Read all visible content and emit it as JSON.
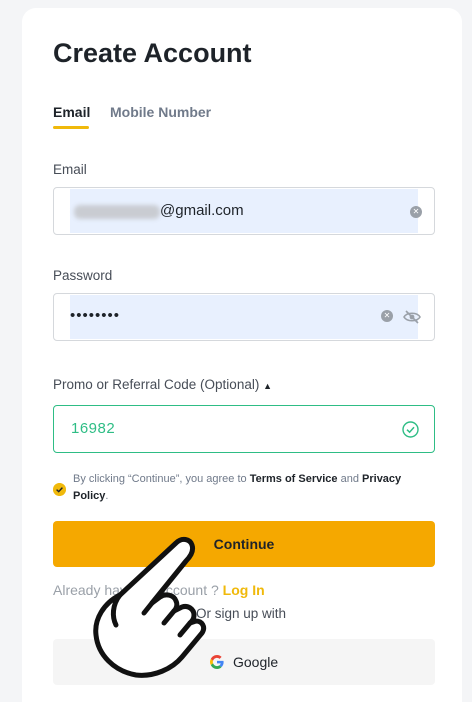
{
  "form": {
    "title": "Create Account",
    "tabs": [
      {
        "label": "Email",
        "active": true
      },
      {
        "label": "Mobile Number",
        "active": false
      }
    ],
    "email": {
      "label": "Email",
      "value_suffix": "@gmail.com"
    },
    "password": {
      "label": "Password",
      "masked_value": "••••••••"
    },
    "promo": {
      "label": "Promo or Referral Code (Optional)",
      "toggle_glyph": "▲",
      "value": "16982"
    },
    "agreement": {
      "prefix": "By clicking “Continue”, you agree to ",
      "terms": "Terms of Service",
      "middle": " and ",
      "privacy": "Privacy Policy",
      "suffix": "."
    },
    "continue_label": "Continue",
    "login_prompt": "Already have an account ? ",
    "login_link": "Log In",
    "or_text": "Or sign up with",
    "google_label": "Google"
  },
  "colors": {
    "accent": "#f0b90b",
    "button": "#f5a800",
    "success": "#2ebd85"
  },
  "icons": [
    "clear-icon",
    "eye-slash-icon",
    "check-circle-icon",
    "google-icon",
    "pointing-hand-icon"
  ]
}
